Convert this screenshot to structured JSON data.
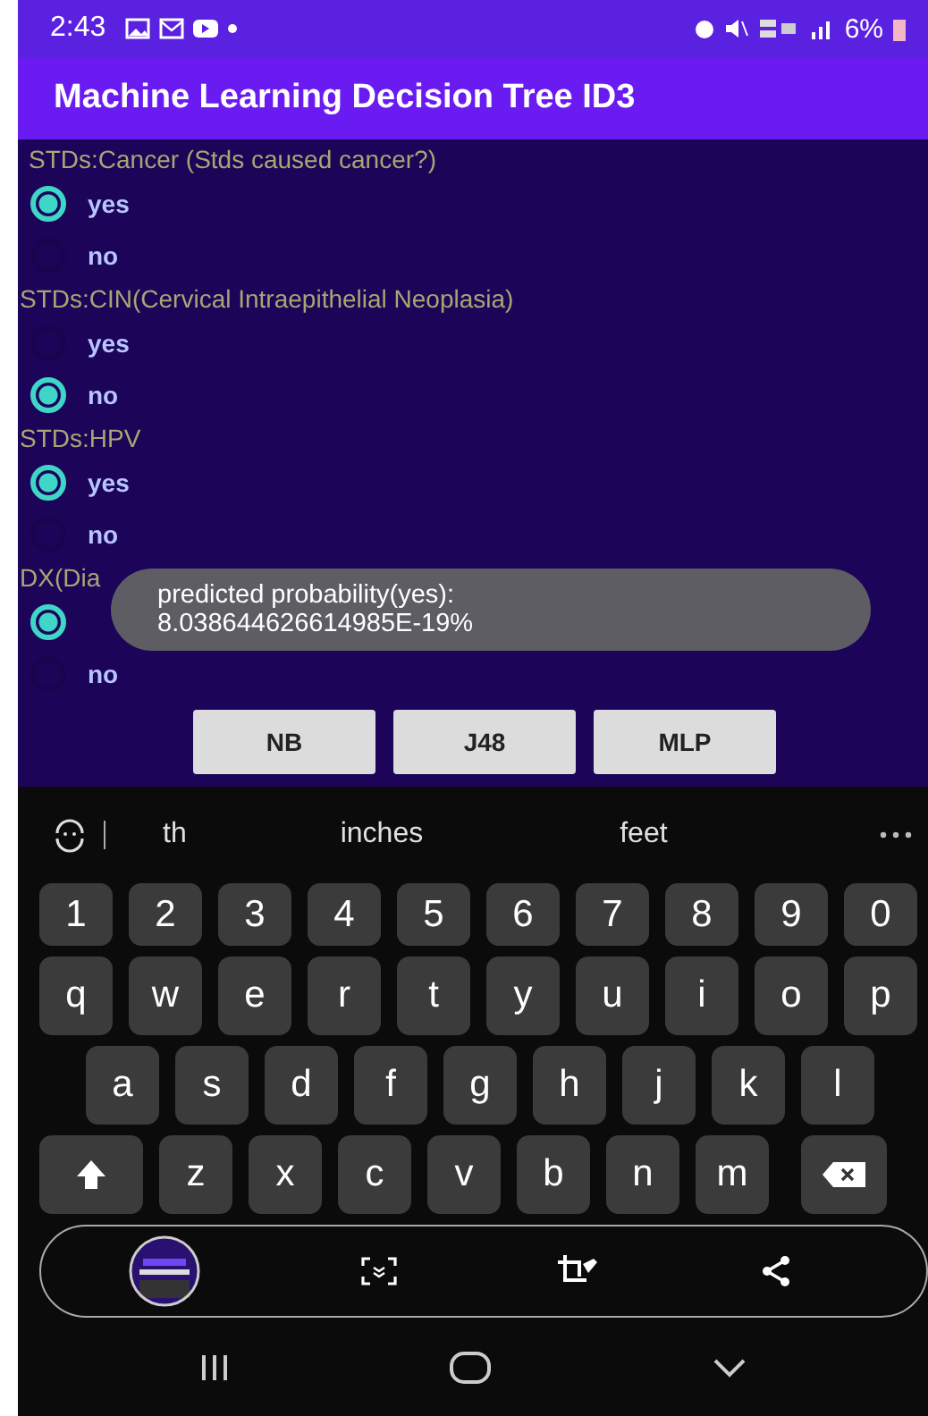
{
  "status_bar": {
    "time": "2:43",
    "battery": "6%"
  },
  "app_bar": {
    "title": "Machine Learning Decision Tree ID3"
  },
  "questions": [
    {
      "label": "STDs:Cancer (Stds caused cancer?)",
      "options": [
        {
          "label": "yes",
          "selected": true
        },
        {
          "label": "no",
          "selected": false
        }
      ]
    },
    {
      "label": "STDs:CIN(Cervical Intraepithelial Neoplasia)",
      "options": [
        {
          "label": "yes",
          "selected": false
        },
        {
          "label": "no",
          "selected": true
        }
      ]
    },
    {
      "label": "STDs:HPV",
      "options": [
        {
          "label": "yes",
          "selected": true
        },
        {
          "label": "no",
          "selected": false
        }
      ]
    },
    {
      "label": "DX(Dia",
      "options": [
        {
          "selected": true
        },
        {
          "label": "no",
          "selected": false
        }
      ]
    }
  ],
  "toast": {
    "lines": [
      "predicted probability(yes):",
      "8.038644626614985E-19%"
    ]
  },
  "buttons": [
    "NB",
    "J48",
    "MLP"
  ],
  "keyboard": {
    "suggestions": [
      "th",
      "inches",
      "feet"
    ],
    "rows": [
      {
        "keys": [
          "1",
          "2",
          "3",
          "4",
          "5",
          "6",
          "7",
          "8",
          "9",
          "0"
        ]
      },
      {
        "keys": [
          "q",
          "w",
          "e",
          "r",
          "t",
          "y",
          "u",
          "i",
          "o",
          "p"
        ]
      },
      {
        "keys": [
          "a",
          "s",
          "d",
          "f",
          "g",
          "h",
          "j",
          "k",
          "l"
        ]
      },
      {
        "keys": [
          "z",
          "x",
          "c",
          "v",
          "b",
          "n",
          "m"
        ]
      }
    ]
  }
}
